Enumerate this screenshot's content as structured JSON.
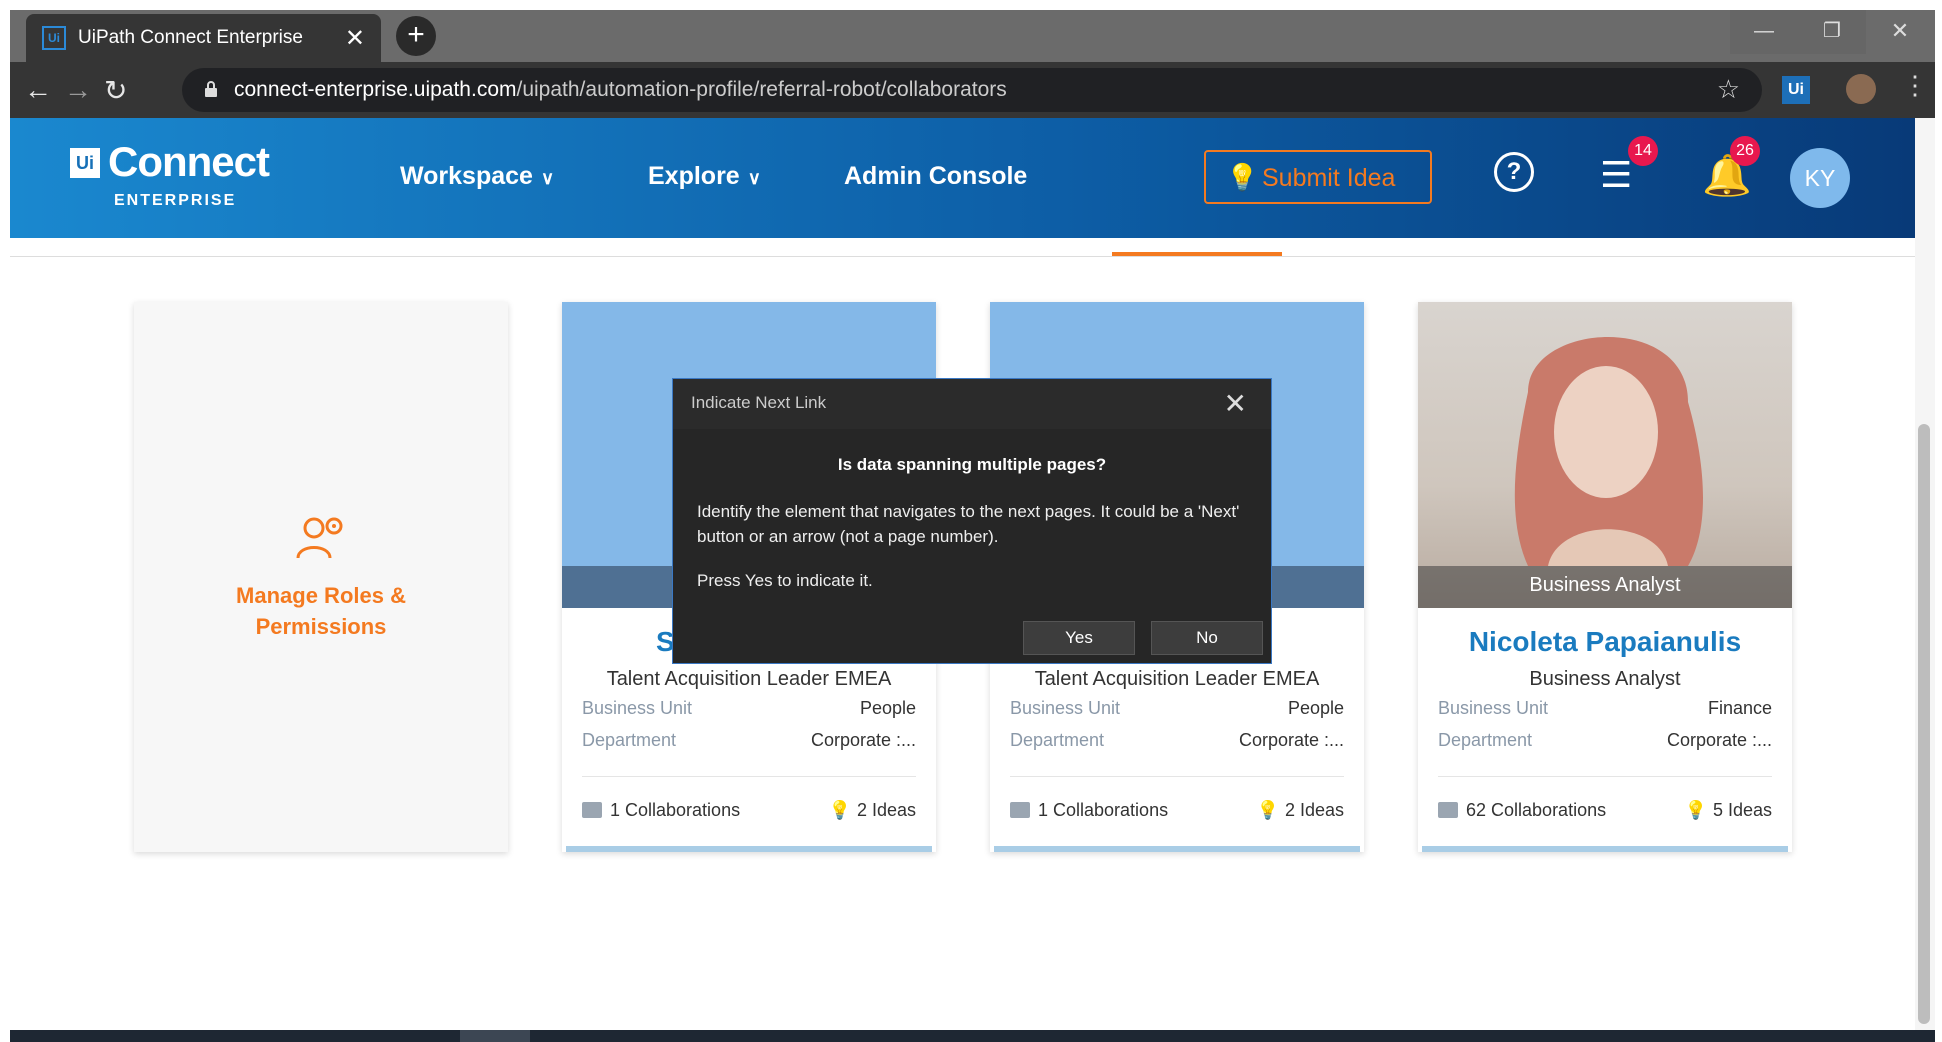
{
  "browser": {
    "tab_title": "UiPath Connect Enterprise",
    "favicon_text": "Ui",
    "url_host": "connect-enterprise.uipath.com",
    "url_path": "/uipath/automation-profile/referral-robot/collaborators",
    "extension_label": "Ui"
  },
  "header": {
    "logo_mark": "Ui",
    "logo_text": "Connect",
    "logo_sub": "ENTERPRISE",
    "nav": [
      "Workspace",
      "Explore",
      "Admin Console"
    ],
    "submit_label": "Submit Idea",
    "tasks_badge": "14",
    "notifications_badge": "26",
    "avatar_initials": "KY"
  },
  "manage_card": {
    "label_line1": "Manage Roles &",
    "label_line2": "Permissions"
  },
  "cards": [
    {
      "name": "S",
      "role": "Talent Acquisition Leader EMEA",
      "business_unit_label": "Business Unit",
      "business_unit": "People",
      "department_label": "Department",
      "department": "Corporate :...",
      "collaborations": "1 Collaborations",
      "ideas": "2 Ideas"
    },
    {
      "name": "",
      "role": "Talent Acquisition Leader EMEA",
      "business_unit_label": "Business Unit",
      "business_unit": "People",
      "department_label": "Department",
      "department": "Corporate :...",
      "collaborations": "1 Collaborations",
      "ideas": "2 Ideas"
    },
    {
      "photo_label": "Business Analyst",
      "name": "Nicoleta Papaianulis",
      "role": "Business Analyst",
      "business_unit_label": "Business Unit",
      "business_unit": "Finance",
      "department_label": "Department",
      "department": "Corporate :...",
      "collaborations": "62 Collaborations",
      "ideas": "5 Ideas"
    }
  ],
  "dialog": {
    "title": "Indicate Next Link",
    "question": "Is data spanning multiple pages?",
    "body": "Identify the element that navigates to the next pages. It could be a 'Next' button or an arrow (not a page number).",
    "instruction": "Press Yes to indicate it.",
    "yes_label": "Yes",
    "no_label": "No"
  },
  "colors": {
    "accent_orange": "#f47a20",
    "header_blue": "#0d5ea6",
    "name_blue": "#1a7bbf",
    "badge_red": "#e8184e"
  }
}
